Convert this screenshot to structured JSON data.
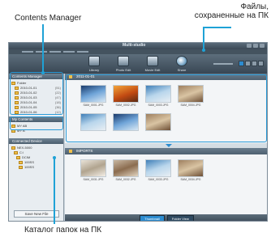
{
  "callouts": {
    "contents_manager": "Contents Manager",
    "pc_files_line1": "Файлы,",
    "pc_files_line2": "сохраненные на ПК",
    "pc_catalog": "Каталог папок на ПК"
  },
  "app": {
    "title": "Multi-studio",
    "toolbar": [
      {
        "label": "Library",
        "icon": "library-icon"
      },
      {
        "label": "Photo Edit",
        "icon": "photo-edit-icon"
      },
      {
        "label": "Movie Edit",
        "icon": "movie-edit-icon"
      },
      {
        "label": "Share",
        "icon": "share-globe-icon"
      }
    ]
  },
  "left_panel": {
    "contents_manager_title": "Contents Manager",
    "folder_group": "Folder",
    "folders": [
      {
        "name": "2010-01-01",
        "count": "(51)"
      },
      {
        "name": "2010-01-02",
        "count": "(22)"
      },
      {
        "name": "2010-01-03",
        "count": "(47)"
      },
      {
        "name": "2010-01-04",
        "count": "(18)"
      },
      {
        "name": "2010-01-05",
        "count": "(36)"
      },
      {
        "name": "2010-01-06",
        "count": "(12)"
      }
    ],
    "my_contents_title": "My Contents",
    "my_contents": [
      "MY AB",
      "MY B"
    ],
    "connected_device_title": "Connected Device",
    "device_tree": [
      "NEX-5000",
      "C:\\",
      "DCIM",
      "100SS",
      "100SS"
    ],
    "save_button": "Save New File"
  },
  "main": {
    "group1_title": "2011-01-01",
    "group1_thumbs": [
      {
        "caption": "SAM_0001.JPG",
        "style": "p1"
      },
      {
        "caption": "SAM_0002.JPG",
        "style": "p2"
      },
      {
        "caption": "SAM_0003.JPG",
        "style": "p3"
      },
      {
        "caption": "SAM_0004.JPG",
        "style": "p4"
      }
    ],
    "group2_title": "IMPORTS",
    "group2_thumbs": [
      {
        "caption": "SAM_0031.JPG",
        "style": "p5"
      },
      {
        "caption": "SAM_0032.JPG",
        "style": "p6"
      },
      {
        "caption": "SAM_0033.JPG",
        "style": "p3"
      },
      {
        "caption": "SAM_0034.JPG",
        "style": "p4"
      }
    ],
    "bottom_buttons": [
      "Thumbnail",
      "Folder View"
    ]
  },
  "colors": {
    "callout_line": "#1fa2d6",
    "highlight": "#2a9bd8"
  }
}
